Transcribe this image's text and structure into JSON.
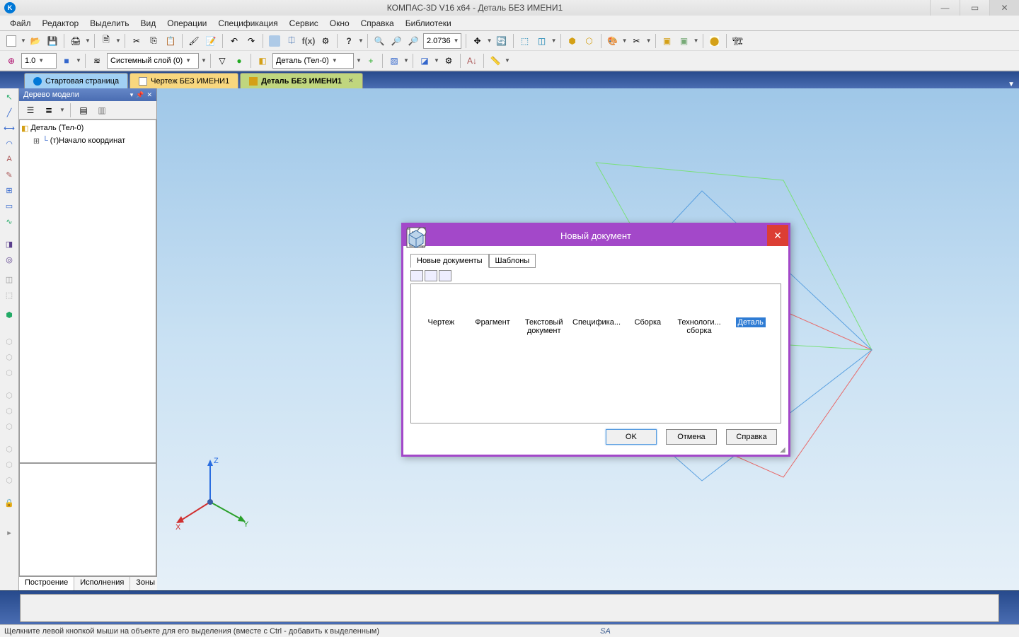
{
  "app": {
    "title": "КОМПАС-3D V16  x64 - Деталь БЕЗ ИМЕНИ1",
    "logo_letter": "K"
  },
  "menu": [
    "Файл",
    "Редактор",
    "Выделить",
    "Вид",
    "Операции",
    "Спецификация",
    "Сервис",
    "Окно",
    "Справка",
    "Библиотеки"
  ],
  "toolbar": {
    "combo_scale": "1.0",
    "combo_layer": "Системный слой (0)",
    "combo_part": "Деталь (Тел-0)",
    "zoom_value": "2.0736"
  },
  "tabs": {
    "start": "Стартовая страница",
    "drawing": "Чертеж БЕЗ ИМЕНИ1",
    "part": "Деталь БЕЗ ИМЕНИ1"
  },
  "tree_panel": {
    "title": "Дерево модели",
    "root": "Деталь (Тел-0)",
    "child": "(т)Начало координат",
    "bottom_tabs": [
      "Построение",
      "Исполнения",
      "Зоны"
    ]
  },
  "dialog": {
    "title": "Новый документ",
    "tab_new": "Новые документы",
    "tab_tpl": "Шаблоны",
    "types": [
      {
        "label": "Чертеж",
        "sub": ""
      },
      {
        "label": "Фрагмент",
        "sub": ""
      },
      {
        "label": "Текстовый",
        "sub": "документ"
      },
      {
        "label": "Специфика...",
        "sub": ""
      },
      {
        "label": "Сборка",
        "sub": ""
      },
      {
        "label": "Технологи...",
        "sub": "сборка"
      },
      {
        "label": "Деталь",
        "sub": ""
      }
    ],
    "selected_index": 6,
    "btn_ok": "OK",
    "btn_cancel": "Отмена",
    "btn_help": "Справка"
  },
  "status": {
    "hint": "Щелкните левой кнопкой мыши на объекте для его выделения (вместе с Ctrl - добавить к выделенным)",
    "indicator": "SA"
  },
  "axis": {
    "x": "X",
    "y": "Y",
    "z": "Z"
  }
}
